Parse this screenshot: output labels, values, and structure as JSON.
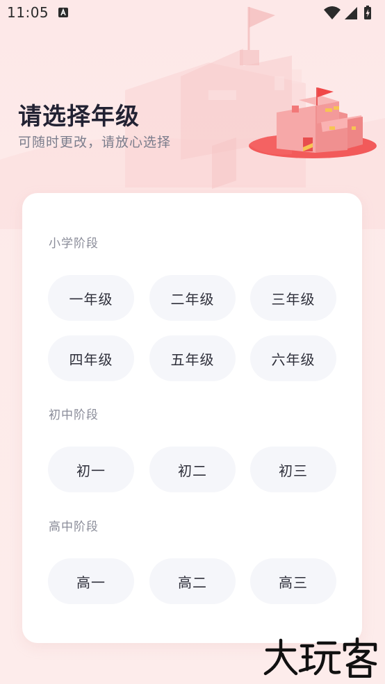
{
  "status_bar": {
    "time": "11:05",
    "icons": [
      "a-notification-icon",
      "wifi-icon",
      "signal-icon",
      "battery-icon"
    ]
  },
  "header": {
    "title": "请选择年级",
    "subtitle": "可随时更改，请放心选择"
  },
  "sections": [
    {
      "label": "小学阶段",
      "grades": [
        "一年级",
        "二年级",
        "三年级",
        "四年级",
        "五年级",
        "六年级"
      ]
    },
    {
      "label": "初中阶段",
      "grades": [
        "初一",
        "初二",
        "初三"
      ]
    },
    {
      "label": "高中阶段",
      "grades": [
        "高一",
        "高二",
        "高三"
      ]
    }
  ],
  "watermark": {
    "text": "大玩客"
  },
  "colors": {
    "background": "#fde8e8",
    "card": "#ffffff",
    "button_bg": "#f5f6fa",
    "title": "#222233",
    "subtitle": "#7b7d8c",
    "accent": "#f07070"
  }
}
